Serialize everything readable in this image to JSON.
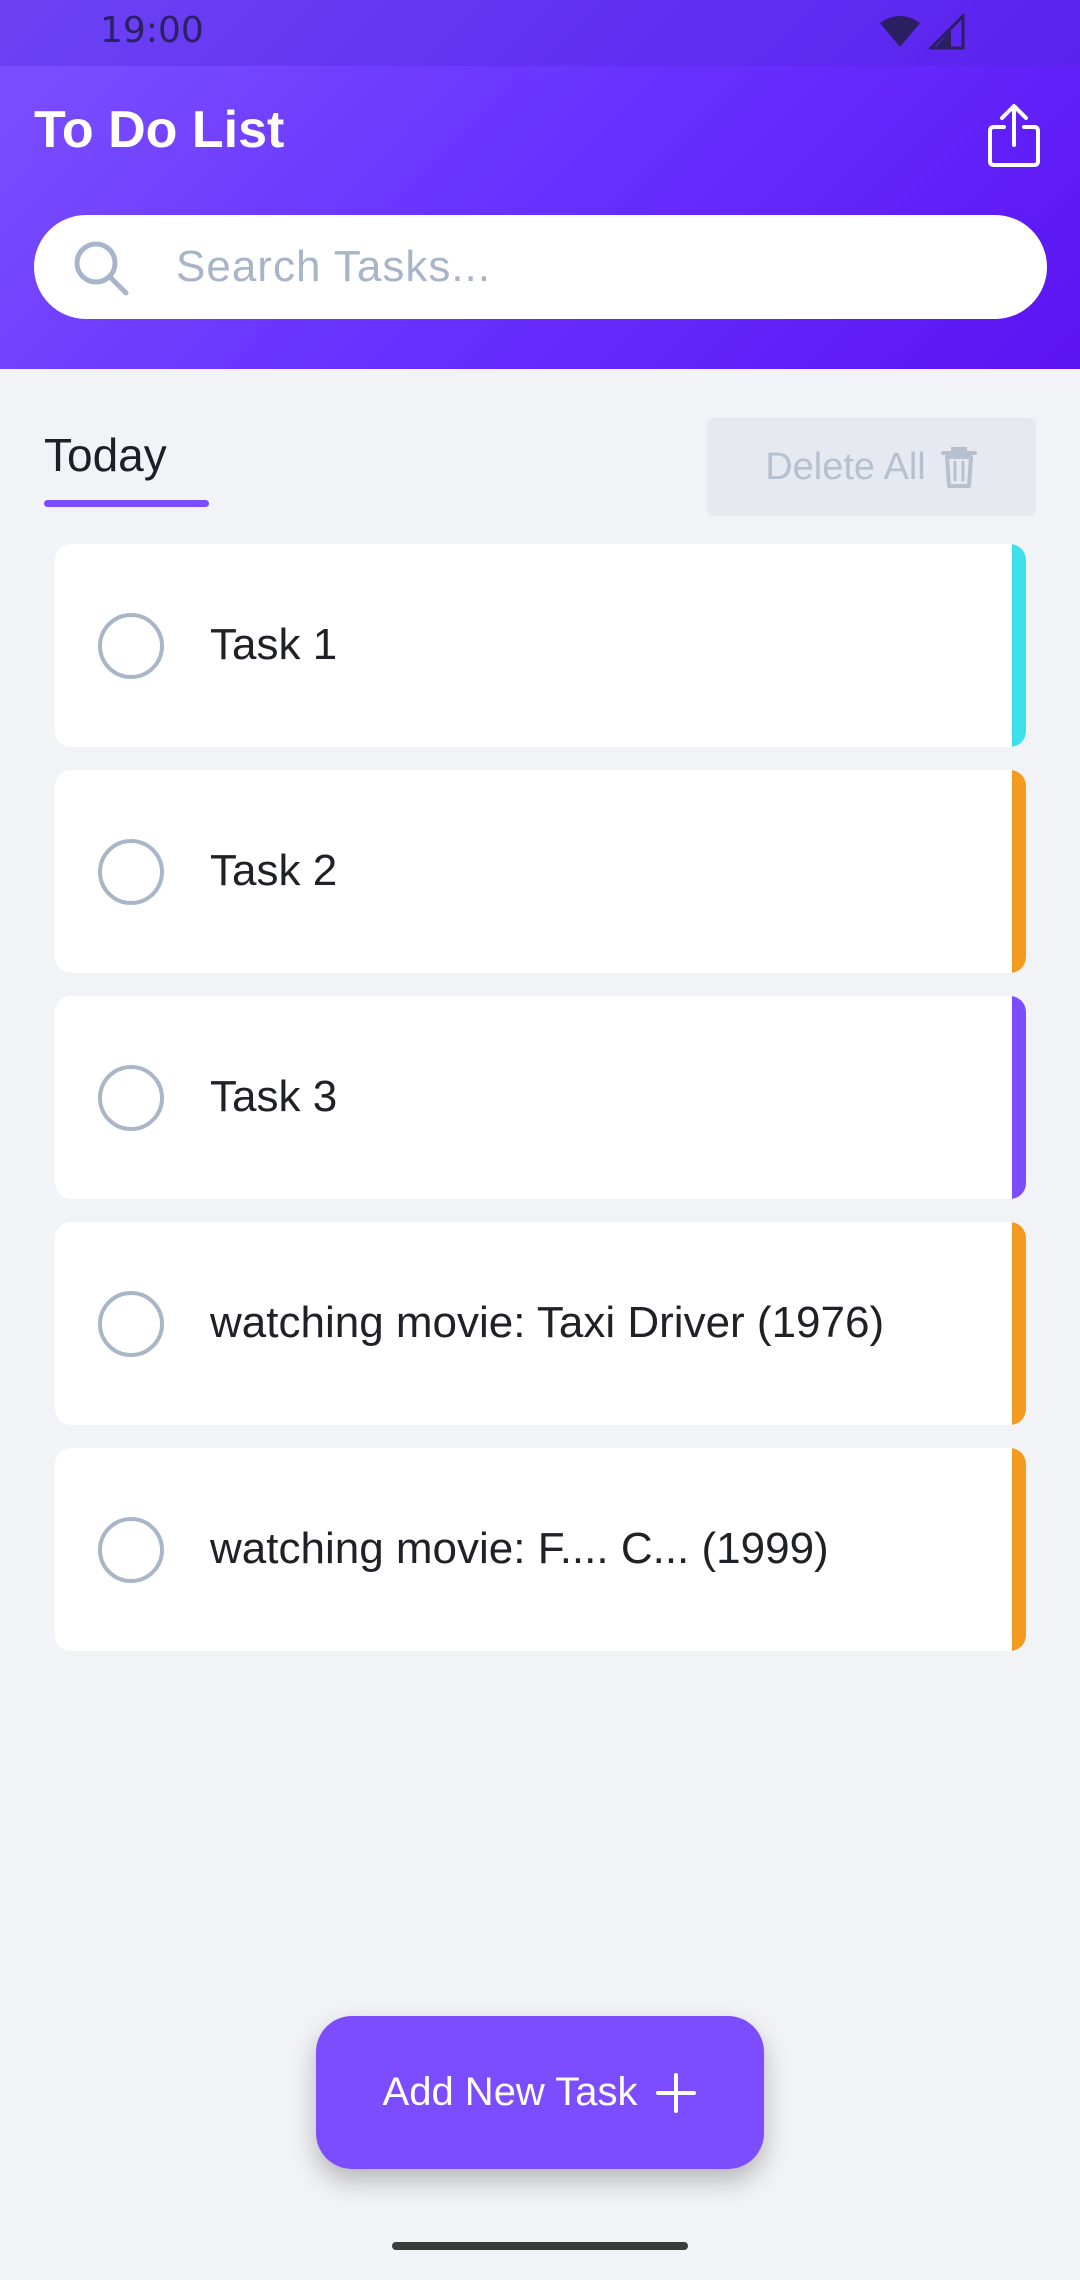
{
  "status_bar": {
    "time": "19:00"
  },
  "header": {
    "title": "To Do List",
    "share_icon": "share-icon"
  },
  "search": {
    "placeholder": "Search Tasks...",
    "value": ""
  },
  "section": {
    "tab_label": "Today",
    "delete_all_label": "Delete All"
  },
  "tasks": [
    {
      "label": "Task 1",
      "accent": "#3ee0ec"
    },
    {
      "label": "Task 2",
      "accent": "#f39a21"
    },
    {
      "label": "Task 3",
      "accent": "#7c4dff"
    },
    {
      "label": "watching movie: Taxi Driver (1976)",
      "accent": "#f39a21"
    },
    {
      "label": "watching movie: F.... C... (1999)",
      "accent": "#f39a21"
    }
  ],
  "add_button": {
    "label": "Add New Task"
  },
  "colors": {
    "primary": "#7c4dff",
    "background": "#f2f3f7",
    "checkbox_border": "#a9b6c8"
  }
}
